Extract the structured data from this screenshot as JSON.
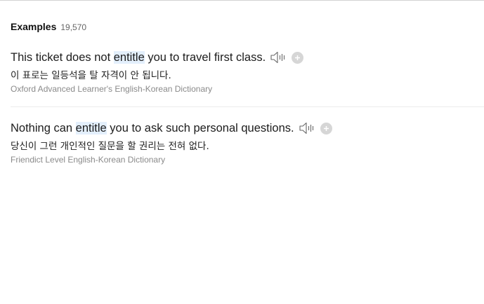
{
  "examples_section": {
    "title": "Examples",
    "count": "19,570"
  },
  "examples": [
    {
      "sentence_before": "This ticket does not ",
      "highlight": "entitle",
      "sentence_after": " you to travel first class.",
      "translation": "이 표로는 일등석을 탈 자격이 안 됩니다.",
      "source": "Oxford Advanced Learner's English-Korean Dictionary"
    },
    {
      "sentence_before": "Nothing can ",
      "highlight": "entitle",
      "sentence_after": " you to ask such personal questions.",
      "translation": "당신이 그런 개인적인 질문을 할 권리는 전혀 없다.",
      "source": "Friendict Level English-Korean Dictionary"
    }
  ],
  "icons": {
    "speaker": "speaker-icon",
    "add": "plus-icon"
  },
  "colors": {
    "highlight_bg": "#e3effc",
    "source_text": "#8a8a8a",
    "icon_gray": "#d6d6d6"
  }
}
